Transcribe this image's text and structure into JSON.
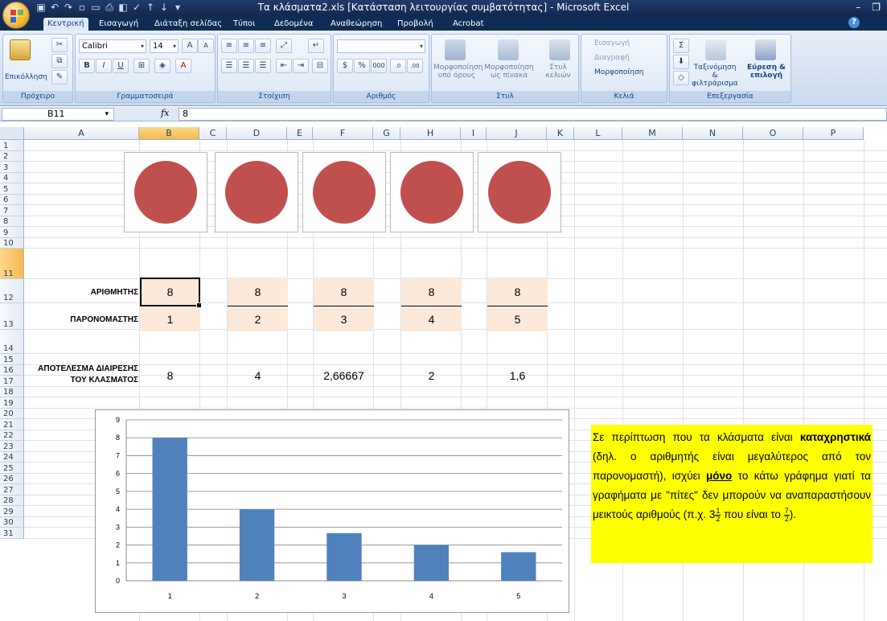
{
  "window": {
    "title": "Τα κλάσματα2.xls  [Κατάσταση λειτουργίας συμβατότητας]  - Microsoft Excel"
  },
  "tabs": [
    "Κεντρική",
    "Εισαγωγή",
    "Διάταξη σελίδας",
    "Τύποι",
    "Δεδομένα",
    "Αναθεώρηση",
    "Προβολή",
    "Acrobat"
  ],
  "ribbon": {
    "clipboard_label": "Πρόχειρο",
    "paste_label": "Επικόλληση",
    "font_group_label": "Γραμματοσειρά",
    "font_name": "Calibri",
    "font_size": "14",
    "alignment_label": "Στοίχιση",
    "number_label": "Αριθμός",
    "number_format": "",
    "cond_format_label": "Μορφοποίηση υπό όρους",
    "format_table_label": "Μορφοποίηση ως πίνακα",
    "cell_styles_label": "Στυλ κελιών",
    "styles_label": "Στυλ",
    "insert_label": "Εισαγωγή",
    "delete_label": "Διαγραφή",
    "format_label": "Μορφοποίηση",
    "cells_label": "Κελιά",
    "sort_label": "Ταξινόμηση & φιλτράρισμα",
    "find_label": "Εύρεση & επιλογή",
    "editing_label": "Επεξεργασία"
  },
  "formula_bar": {
    "name_box": "B11",
    "fx": "fx",
    "value": "8"
  },
  "columns": [
    "A",
    "B",
    "C",
    "D",
    "E",
    "F",
    "G",
    "H",
    "I",
    "J",
    "K",
    "L",
    "M",
    "N",
    "O",
    "P"
  ],
  "rows": [
    "1",
    "2",
    "3",
    "4",
    "5",
    "6",
    "7",
    "8",
    "9",
    "10",
    "11",
    "12",
    "13",
    "14",
    "15",
    "16",
    "17",
    "18",
    "19",
    "20",
    "21",
    "22",
    "23",
    "24",
    "25",
    "26",
    "27",
    "28",
    "29",
    "30",
    "31"
  ],
  "table": {
    "numerator_label": "ΑΡΙΘΜΗΤΗΣ",
    "denominator_label": "ΠΑΡΟΝΟΜΑΣΤΗΣ",
    "result_label_line1": "ΑΠΟΤΕΛΕΣΜΑ ΔΙΑΙΡΕΣΗΣ",
    "result_label_line2": "ΤΟΥ ΚΛΑΣΜΑΤΟΣ",
    "numerators": [
      "8",
      "8",
      "8",
      "8",
      "8"
    ],
    "denominators": [
      "1",
      "2",
      "3",
      "4",
      "5"
    ],
    "results": [
      "8",
      "4",
      "2,66667",
      "2",
      "1,6"
    ]
  },
  "pie_color": "#c0504d",
  "chart_data": {
    "type": "bar",
    "categories": [
      "1",
      "2",
      "3",
      "4",
      "5"
    ],
    "values": [
      8,
      4,
      2.66667,
      2,
      1.6
    ],
    "title": "",
    "xlabel": "",
    "ylabel": "",
    "ylim": [
      0,
      9
    ],
    "yticks": [
      "0",
      "1",
      "2",
      "3",
      "4",
      "5",
      "6",
      "7",
      "8",
      "9"
    ],
    "grid": true,
    "legend": "none",
    "bar_color": "#4f81bd"
  },
  "note": {
    "p1": "Σε περίπτωση που τα κλάσματα είναι",
    "bold1": "καταχρηστικά",
    "p2": " (δηλ. ο αριθμητής είναι μεγαλύτερος από τον παρονομαστή), ισχύει",
    "bold2": "μόνο",
    "p3": " το κάτω γράφημα γιατί τα γραφήματα με \"πίτες\" δεν μπορούν να αναπαραστήσουν μεικτούς αριθμούς (π.χ. 3",
    "frac1_num": "1",
    "frac1_den": "2",
    "p4": " που είναι το ",
    "frac2_num": "7",
    "frac2_den": "2",
    "p5": ")."
  }
}
